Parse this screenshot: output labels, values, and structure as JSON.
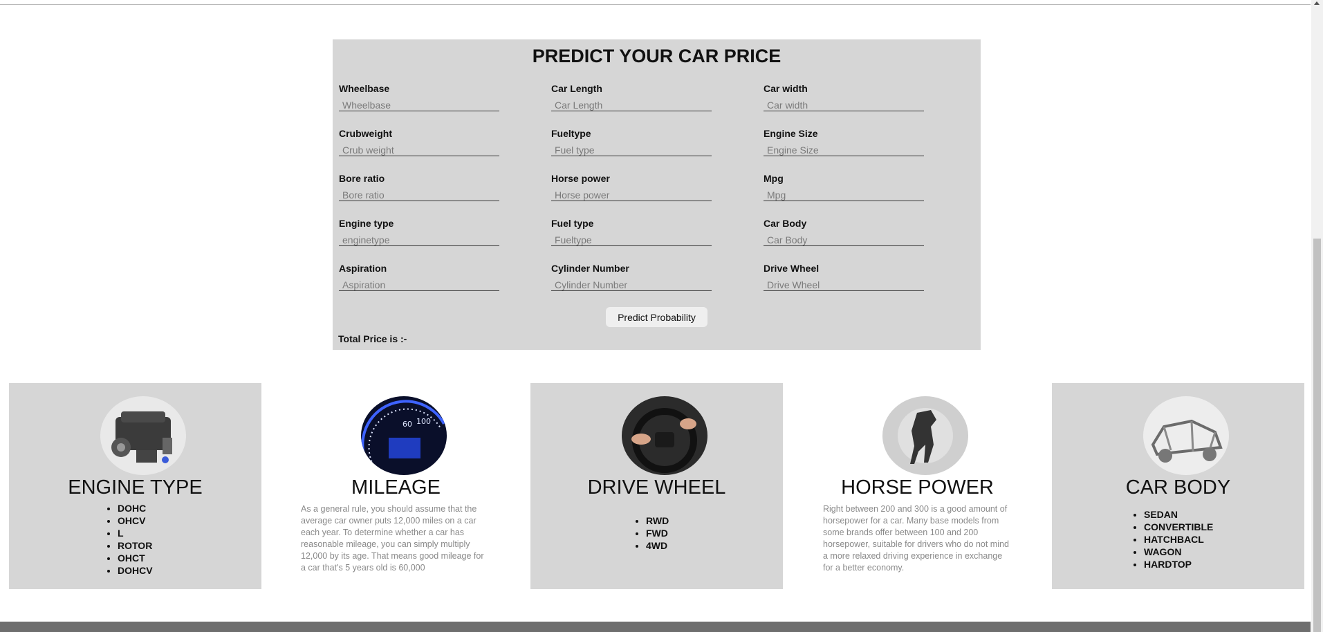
{
  "form": {
    "title": "PREDICT YOUR CAR PRICE",
    "fields": [
      {
        "label": "Wheelbase",
        "placeholder": "Wheelbase"
      },
      {
        "label": "Car Length",
        "placeholder": "Car Length"
      },
      {
        "label": "Car width",
        "placeholder": "Car width"
      },
      {
        "label": "Crubweight",
        "placeholder": "Crub weight"
      },
      {
        "label": "Fueltype",
        "placeholder": "Fuel type"
      },
      {
        "label": "Engine Size",
        "placeholder": "Engine Size"
      },
      {
        "label": "Bore ratio",
        "placeholder": "Bore ratio"
      },
      {
        "label": "Horse power",
        "placeholder": "Horse power"
      },
      {
        "label": "Mpg",
        "placeholder": "Mpg"
      },
      {
        "label": "Engine type",
        "placeholder": "enginetype"
      },
      {
        "label": "Fuel type",
        "placeholder": "Fueltype"
      },
      {
        "label": "Car Body",
        "placeholder": "Car Body"
      },
      {
        "label": "Aspiration",
        "placeholder": "Aspiration"
      },
      {
        "label": "Cylinder Number",
        "placeholder": "Cylinder Number"
      },
      {
        "label": "Drive Wheel",
        "placeholder": "Drive Wheel"
      }
    ],
    "button_label": "Predict Probability",
    "total_price_label": "Total Price is :-"
  },
  "cards": [
    {
      "title": "ENGINE TYPE",
      "image": "engine-image",
      "items": [
        "DOHC",
        "OHCV",
        "L",
        "ROTOR",
        "OHCT",
        "DOHCV"
      ]
    },
    {
      "title": "MILEAGE",
      "image": "speedometer-image",
      "text": "As a general rule, you should assume that the average car owner puts 12,000 miles on a car each year. To determine whether a car has reasonable mileage, you can simply multiply 12,000 by its age. That means good mileage for a car that's 5 years old is 60,000"
    },
    {
      "title": "DRIVE WHEEL",
      "image": "steering-wheel-image",
      "items": [
        "RWD",
        "FWD",
        "4WD"
      ]
    },
    {
      "title": "HORSE POWER",
      "image": "horse-image",
      "text": "Right between 200 and 300 is a good amount of horsepower for a car. Many base models from some brands offer between 100 and 200 horsepower, suitable for drivers who do not mind a more relaxed driving experience in exchange for a better economy."
    },
    {
      "title": "CAR BODY",
      "image": "car-chassis-image",
      "items": [
        "SEDAN",
        "CONVERTIBLE",
        "HATCHBACL",
        "WAGON",
        "HARDTOP"
      ]
    }
  ],
  "colors": {
    "panel": "#d6d6d6",
    "footer": "#6e6e6e",
    "button": "#efefef"
  }
}
